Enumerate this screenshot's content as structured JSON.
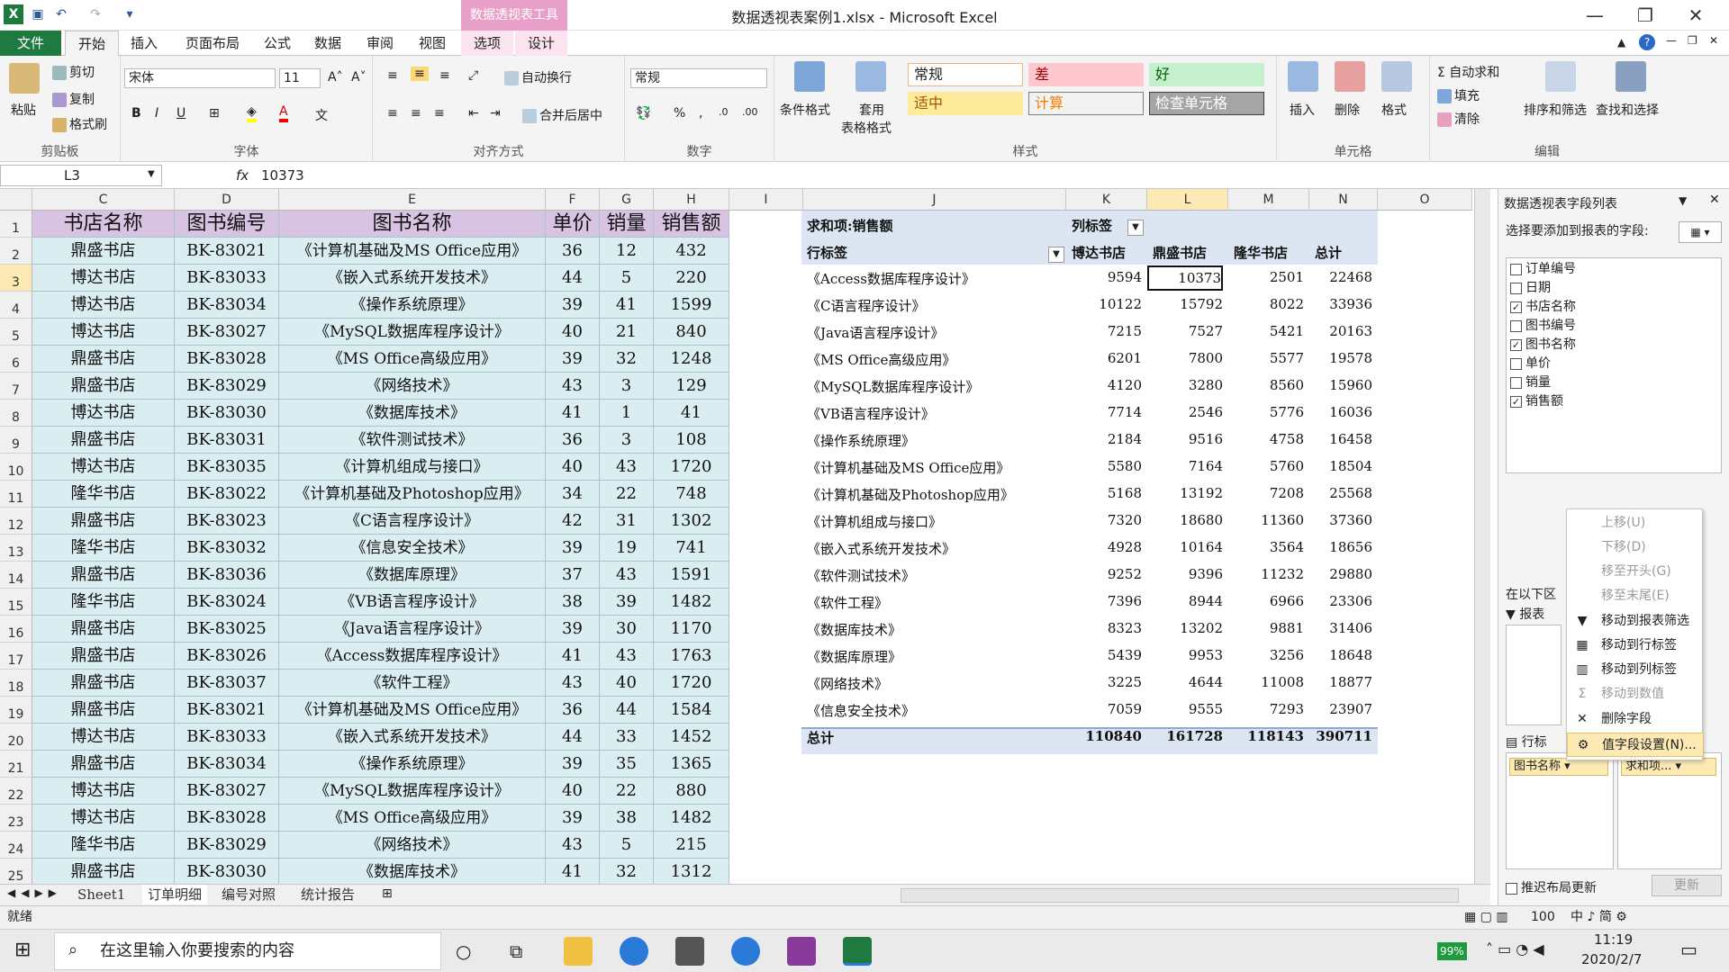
{
  "window": {
    "title": "数据透视表案例1.xlsx - Microsoft Excel",
    "context_tab": "数据透视表工具"
  },
  "tabs": [
    "文件",
    "开始",
    "插入",
    "页面布局",
    "公式",
    "数据",
    "审阅",
    "视图",
    "选项",
    "设计"
  ],
  "ribbon": {
    "clipboard": {
      "label": "剪贴板",
      "paste": "粘贴",
      "cut": "剪切",
      "copy": "复制",
      "format_painter": "格式刷"
    },
    "font": {
      "label": "字体",
      "name": "宋体",
      "size": "11"
    },
    "align": {
      "label": "对齐方式",
      "wrap": "自动换行",
      "merge": "合并后居中"
    },
    "number": {
      "label": "数字",
      "format": "常规"
    },
    "styles": {
      "label": "样式",
      "cond": "条件格式",
      "table1": "套用",
      "table2": "表格格式",
      "boxes": [
        {
          "t": "常规",
          "bg": "#ffffff",
          "bd": "#f4b183",
          "c": "#222"
        },
        {
          "t": "差",
          "bg": "#ffc7ce",
          "bd": "#ffc7ce",
          "c": "#9c0006"
        },
        {
          "t": "好",
          "bg": "#c6efce",
          "bd": "#c6efce",
          "c": "#006100"
        },
        {
          "t": "适中",
          "bg": "#ffeb9c",
          "bd": "#ffeb9c",
          "c": "#9c5700"
        },
        {
          "t": "计算",
          "bg": "#f2f2f2",
          "bd": "#7f7f7f",
          "c": "#fa7d00"
        },
        {
          "t": "检查单元格",
          "bg": "#a5a5a5",
          "bd": "#3f3f3f",
          "c": "#ffffff"
        }
      ]
    },
    "cells": {
      "label": "单元格",
      "insert": "插入",
      "delete": "删除",
      "format": "格式"
    },
    "edit": {
      "label": "编辑",
      "autosum": "自动求和",
      "fill": "填充",
      "clear": "清除",
      "sort": "排序和筛选",
      "find": "查找和选择"
    }
  },
  "formula_bar": {
    "name_box": "L3",
    "fx": "fx",
    "value": "10373"
  },
  "col_headers": [
    "C",
    "D",
    "E",
    "F",
    "G",
    "H",
    "I",
    "J",
    "K",
    "L",
    "M",
    "N",
    "O"
  ],
  "rows": [
    "1",
    "2",
    "3",
    "4",
    "5",
    "6",
    "7",
    "8",
    "9",
    "10",
    "11",
    "12",
    "13",
    "14",
    "15",
    "16",
    "17",
    "18",
    "19",
    "20",
    "21",
    "22",
    "23",
    "24",
    "25"
  ],
  "table_header": [
    "书店名称",
    "图书编号",
    "图书名称",
    "单价",
    "销量",
    "销售额"
  ],
  "table": [
    [
      "鼎盛书店",
      "BK-83021",
      "《计算机基础及MS Office应用》",
      "36",
      "12",
      "432"
    ],
    [
      "博达书店",
      "BK-83033",
      "《嵌入式系统开发技术》",
      "44",
      "5",
      "220"
    ],
    [
      "博达书店",
      "BK-83034",
      "《操作系统原理》",
      "39",
      "41",
      "1599"
    ],
    [
      "博达书店",
      "BK-83027",
      "《MySQL数据库程序设计》",
      "40",
      "21",
      "840"
    ],
    [
      "鼎盛书店",
      "BK-83028",
      "《MS Office高级应用》",
      "39",
      "32",
      "1248"
    ],
    [
      "鼎盛书店",
      "BK-83029",
      "《网络技术》",
      "43",
      "3",
      "129"
    ],
    [
      "博达书店",
      "BK-83030",
      "《数据库技术》",
      "41",
      "1",
      "41"
    ],
    [
      "鼎盛书店",
      "BK-83031",
      "《软件测试技术》",
      "36",
      "3",
      "108"
    ],
    [
      "博达书店",
      "BK-83035",
      "《计算机组成与接口》",
      "40",
      "43",
      "1720"
    ],
    [
      "隆华书店",
      "BK-83022",
      "《计算机基础及Photoshop应用》",
      "34",
      "22",
      "748"
    ],
    [
      "鼎盛书店",
      "BK-83023",
      "《C语言程序设计》",
      "42",
      "31",
      "1302"
    ],
    [
      "隆华书店",
      "BK-83032",
      "《信息安全技术》",
      "39",
      "19",
      "741"
    ],
    [
      "鼎盛书店",
      "BK-83036",
      "《数据库原理》",
      "37",
      "43",
      "1591"
    ],
    [
      "隆华书店",
      "BK-83024",
      "《VB语言程序设计》",
      "38",
      "39",
      "1482"
    ],
    [
      "鼎盛书店",
      "BK-83025",
      "《Java语言程序设计》",
      "39",
      "30",
      "1170"
    ],
    [
      "鼎盛书店",
      "BK-83026",
      "《Access数据库程序设计》",
      "41",
      "43",
      "1763"
    ],
    [
      "鼎盛书店",
      "BK-83037",
      "《软件工程》",
      "43",
      "40",
      "1720"
    ],
    [
      "鼎盛书店",
      "BK-83021",
      "《计算机基础及MS Office应用》",
      "36",
      "44",
      "1584"
    ],
    [
      "博达书店",
      "BK-83033",
      "《嵌入式系统开发技术》",
      "44",
      "33",
      "1452"
    ],
    [
      "鼎盛书店",
      "BK-83034",
      "《操作系统原理》",
      "39",
      "35",
      "1365"
    ],
    [
      "博达书店",
      "BK-83027",
      "《MySQL数据库程序设计》",
      "40",
      "22",
      "880"
    ],
    [
      "博达书店",
      "BK-83028",
      "《MS Office高级应用》",
      "39",
      "38",
      "1482"
    ],
    [
      "隆华书店",
      "BK-83029",
      "《网络技术》",
      "43",
      "5",
      "215"
    ],
    [
      "鼎盛书店",
      "BK-83030",
      "《数据库技术》",
      "41",
      "32",
      "1312"
    ]
  ],
  "pivot": {
    "sum_label": "求和项:销售额",
    "col_label": "列标签",
    "row_label": "行标签",
    "stores": [
      "博达书店",
      "鼎盛书店",
      "隆华书店",
      "总计"
    ],
    "rows": [
      [
        "《Access数据库程序设计》",
        "9594",
        "10373",
        "2501",
        "22468"
      ],
      [
        "《C语言程序设计》",
        "10122",
        "15792",
        "8022",
        "33936"
      ],
      [
        "《Java语言程序设计》",
        "7215",
        "7527",
        "5421",
        "20163"
      ],
      [
        "《MS Office高级应用》",
        "6201",
        "7800",
        "5577",
        "19578"
      ],
      [
        "《MySQL数据库程序设计》",
        "4120",
        "3280",
        "8560",
        "15960"
      ],
      [
        "《VB语言程序设计》",
        "7714",
        "2546",
        "5776",
        "16036"
      ],
      [
        "《操作系统原理》",
        "2184",
        "9516",
        "4758",
        "16458"
      ],
      [
        "《计算机基础及MS Office应用》",
        "5580",
        "7164",
        "5760",
        "18504"
      ],
      [
        "《计算机基础及Photoshop应用》",
        "5168",
        "13192",
        "7208",
        "25568"
      ],
      [
        "《计算机组成与接口》",
        "7320",
        "18680",
        "11360",
        "37360"
      ],
      [
        "《嵌入式系统开发技术》",
        "4928",
        "10164",
        "3564",
        "18656"
      ],
      [
        "《软件测试技术》",
        "9252",
        "9396",
        "11232",
        "29880"
      ],
      [
        "《软件工程》",
        "7396",
        "8944",
        "6966",
        "23306"
      ],
      [
        "《数据库技术》",
        "8323",
        "13202",
        "9881",
        "31406"
      ],
      [
        "《数据库原理》",
        "5439",
        "9953",
        "3256",
        "18648"
      ],
      [
        "《网络技术》",
        "3225",
        "4644",
        "11008",
        "18877"
      ],
      [
        "《信息安全技术》",
        "7059",
        "9555",
        "7293",
        "23907"
      ]
    ],
    "total": [
      "总计",
      "110840",
      "161728",
      "118143",
      "390711"
    ]
  },
  "sheet_tabs": [
    "Sheet1",
    "订单明细",
    "编号对照",
    "统计报告"
  ],
  "status": {
    "ready": "就绪",
    "zoom": "100"
  },
  "field_list": {
    "title": "数据透视表字段列表",
    "prompt": "选择要添加到报表的字段:",
    "fields": [
      {
        "n": "订单编号",
        "c": false
      },
      {
        "n": "日期",
        "c": false
      },
      {
        "n": "书店名称",
        "c": true
      },
      {
        "n": "图书编号",
        "c": false
      },
      {
        "n": "图书名称",
        "c": true
      },
      {
        "n": "单价",
        "c": false
      },
      {
        "n": "销量",
        "c": false
      },
      {
        "n": "销售额",
        "c": true
      }
    ],
    "area_text": "在以下区",
    "filter": "报表",
    "rows": "行标",
    "row_field": "图书名称",
    "value_field": "求和项...",
    "defer": "推迟布局更新",
    "update": "更新"
  },
  "context_menu": [
    {
      "t": "上移(U)",
      "d": true,
      "i": ""
    },
    {
      "t": "下移(D)",
      "d": true,
      "i": ""
    },
    {
      "t": "移至开头(G)",
      "d": true,
      "i": ""
    },
    {
      "t": "移至末尾(E)",
      "d": true,
      "i": ""
    },
    {
      "t": "移动到报表筛选",
      "d": false,
      "i": "▼"
    },
    {
      "t": "移动到行标签",
      "d": false,
      "i": "▦"
    },
    {
      "t": "移动到列标签",
      "d": false,
      "i": "▥"
    },
    {
      "t": "移动到数值",
      "d": true,
      "i": "Σ"
    },
    {
      "t": "删除字段",
      "d": false,
      "i": "✕"
    },
    {
      "t": "值字段设置(N)...",
      "d": false,
      "i": "⚙"
    }
  ],
  "taskbar": {
    "search": "在这里输入你要搜索的内容",
    "battery": "99%",
    "time": "11:19",
    "date": "2020/2/7"
  }
}
